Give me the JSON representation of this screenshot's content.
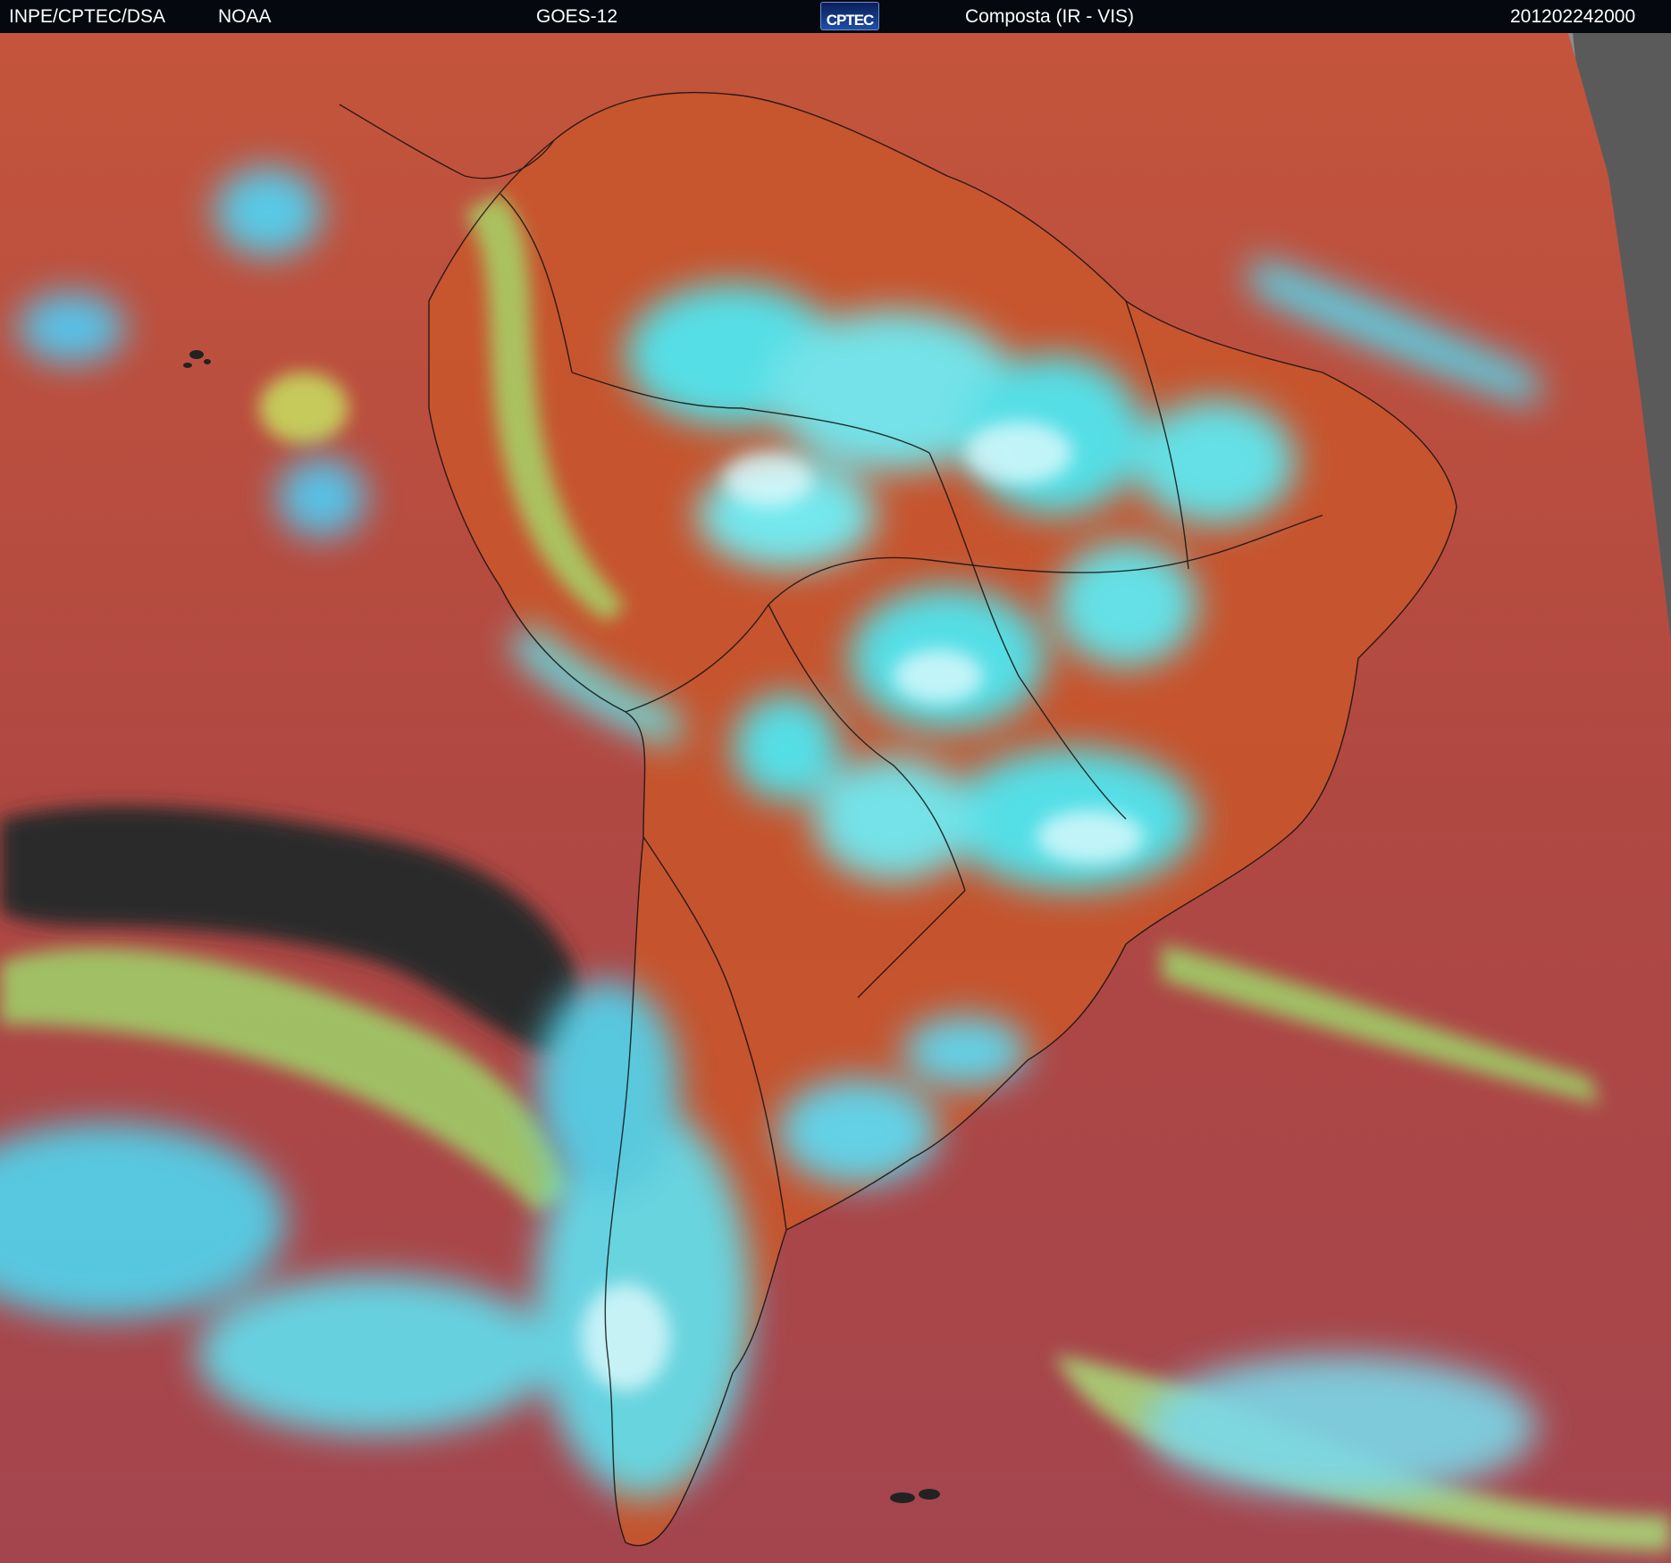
{
  "header": {
    "org": "INPE/CPTEC/DSA",
    "agency": "NOAA",
    "satellite": "GOES-12",
    "logo_text": "CPTEC",
    "product": "Composta (IR - VIS)",
    "timestamp": "201202242000"
  },
  "colors": {
    "header_bg": "#05080f",
    "ocean_base": "#b24a40",
    "land_warm": "#c8552c",
    "cloud_cyan": "#4fe6f0",
    "cloud_light": "#c9f6ff",
    "cloud_green": "#9fd56a",
    "dark_clouds": "#2a2a2a",
    "no_data": "#8c8c8c",
    "border_lines": "#111111"
  }
}
